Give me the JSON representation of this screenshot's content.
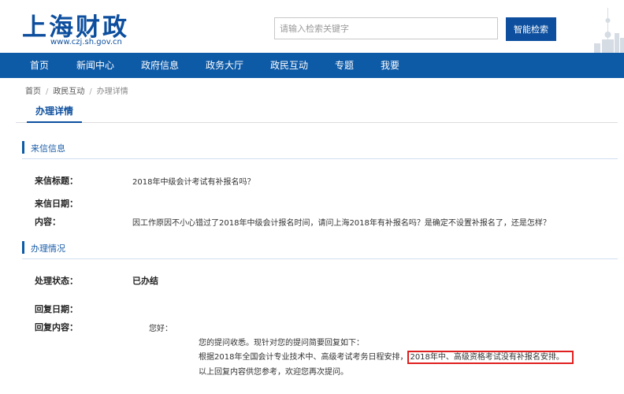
{
  "header": {
    "site_title": "上海财政",
    "site_url": "www.czj.sh.gov.cn",
    "search": {
      "placeholder": "请输入检索关键字",
      "button": "智能检索"
    }
  },
  "nav": {
    "items": [
      "首页",
      "新闻中心",
      "政府信息",
      "政务大厅",
      "政民互动",
      "专题",
      "我要"
    ]
  },
  "breadcrumb": [
    "首页",
    "政民互动",
    "办理详情"
  ],
  "page_tab": "办理详情",
  "letter": {
    "section_title": "来信信息",
    "title_label": "来信标题：",
    "title_value": "2018年中级会计考试有补报名吗？",
    "date_label": "来信日期：",
    "content_label": "内容：",
    "content_value": "因工作原因不小心错过了2018年中级会计报名时间，请问上海2018年有补报名吗？是确定不设置补报名了，还是怎样？"
  },
  "handling": {
    "section_title": "办理情况",
    "status_label": "处理状态：",
    "status_value": "已办结",
    "reply_date_label": "回复日期：",
    "reply_content_label": "回复内容：",
    "greeting": "您好：",
    "line1": "您的提问收悉。现针对您的提问简要回复如下：",
    "line2_prefix": "根据2018年全国会计专业技术中、高级考试考务日程安排，",
    "line2_highlight": "2018年中、高级资格考试没有补报名安排。",
    "line3": "以上回复内容供您参考，欢迎您再次提问。"
  },
  "colors": {
    "brand_blue": "#0d4f9e",
    "nav_blue": "#0d5aa7",
    "highlight_red": "#e02020"
  }
}
